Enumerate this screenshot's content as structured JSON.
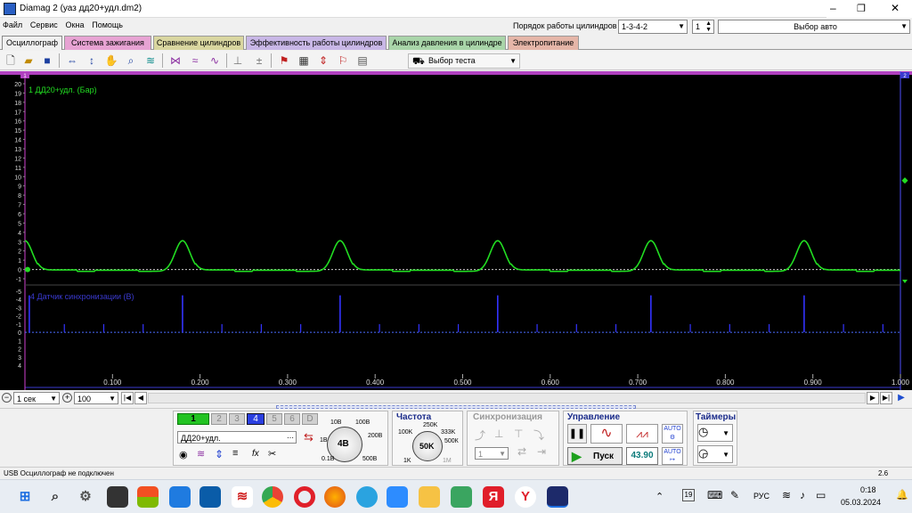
{
  "window": {
    "title": "Diamag 2 (уаз дд20+удл.dm2)",
    "minimize": "–",
    "restore": "❐",
    "close": "✕"
  },
  "menu": [
    "Файл",
    "Сервис",
    "Окна",
    "Помощь"
  ],
  "cylinder_order": {
    "label": "Порядок работы цилиндров",
    "value": "1-3-4-2",
    "spin": "1",
    "auto_select": "Выбор авто"
  },
  "tabs": [
    {
      "label": "Осциллограф",
      "color": "#f0f0f0",
      "active": true
    },
    {
      "label": "Система зажигания",
      "color": "#e7a3d3"
    },
    {
      "label": "Сравнение цилиндров",
      "color": "#d9d6a0"
    },
    {
      "label": "Эффективность работы цилиндров",
      "color": "#c8b7e6"
    },
    {
      "label": "Анализ давления в цилиндре",
      "color": "#a9d5a9"
    },
    {
      "label": "Электропитание",
      "color": "#e5b6a8"
    }
  ],
  "toolbar": {
    "icons": [
      "new-file-icon",
      "open-file-icon",
      "save-icon",
      "cursor-icon",
      "amplitude-icon",
      "hand-icon",
      "zoom-icon",
      "filter-icon",
      "compare-icon",
      "spectrum-icon",
      "wave-icon",
      "level-icon",
      "zero-icon",
      "marker-icon",
      "grid-icon",
      "scale-icon",
      "flag-icon",
      "report-icon"
    ],
    "test_select": "Выбор теста"
  },
  "channels": [
    {
      "name": "1 ДД20+удл. (Бар)",
      "color": "#22dd22",
      "marker": "1"
    },
    {
      "name": "4 Датчик синхронизации (В)",
      "color": "#3333ff",
      "marker": "2"
    }
  ],
  "ch1_yticks": [
    "20",
    "19",
    "18",
    "17",
    "16",
    "15",
    "14",
    "13",
    "12",
    "11",
    "10",
    "9",
    "8",
    "7",
    "6",
    "5",
    "4",
    "3",
    "2",
    "1",
    "0",
    "-1"
  ],
  "ch2_yticks": [
    "-5",
    "-4",
    "-3",
    "-2",
    "-1",
    "0",
    "1",
    "2",
    "3",
    "4"
  ],
  "xticks": [
    "0.100",
    "0.200",
    "0.300",
    "0.400",
    "0.500",
    "0.600",
    "0.700",
    "0.800",
    "0.900",
    "1.000"
  ],
  "chart_data": {
    "type": "line",
    "xlim": [
      0,
      1.0
    ],
    "series": [
      {
        "name": "1 ДД20+удл. (Бар)",
        "peaks_x": [
          0.0,
          0.18,
          0.36,
          0.54,
          0.715,
          0.89
        ],
        "peak_value": 3.3,
        "baseline": 0.0,
        "ylim": [
          -1,
          20
        ]
      },
      {
        "name": "4 Датчик синхронизации (В)",
        "spikes_x": [
          0.005,
          0.18,
          0.36,
          0.54,
          0.715,
          0.89
        ],
        "spike_value": -4.5,
        "small_spikes_x": [
          0.045,
          0.09,
          0.135,
          0.225,
          0.27,
          0.315,
          0.405,
          0.45,
          0.495,
          0.585,
          0.63,
          0.675,
          0.76,
          0.805,
          0.85,
          0.935,
          0.98
        ],
        "small_spike_value": -1.0,
        "ylim": [
          -5,
          4
        ]
      }
    ]
  },
  "xrow": {
    "time_scale": "1 сек",
    "zoom": "100"
  },
  "channels_panel": {
    "buttons": [
      "1",
      "2",
      "3",
      "4",
      "5",
      "6",
      "D"
    ],
    "channel_name": "ДД20+удл.",
    "ranges": [
      "1В",
      "10В",
      "100В",
      "200В",
      "500В",
      "0.1В"
    ],
    "range_value": "4В"
  },
  "frequency": {
    "title": "Частота",
    "labels": [
      "100K",
      "250K",
      "333K",
      "500К",
      "1K",
      "1M"
    ],
    "value": "50K"
  },
  "sync": {
    "title": "Синхронизация",
    "value": "1"
  },
  "control": {
    "title": "Управление",
    "start": "Пуск",
    "value": "43.90"
  },
  "timers": {
    "title": "Таймеры"
  },
  "status": {
    "text": "USB Осциллограф не подключен",
    "right": "2.6"
  },
  "taskbar": {
    "lang": "РУС",
    "time": "0:18",
    "date": "05.03.2024",
    "badge": "19"
  }
}
